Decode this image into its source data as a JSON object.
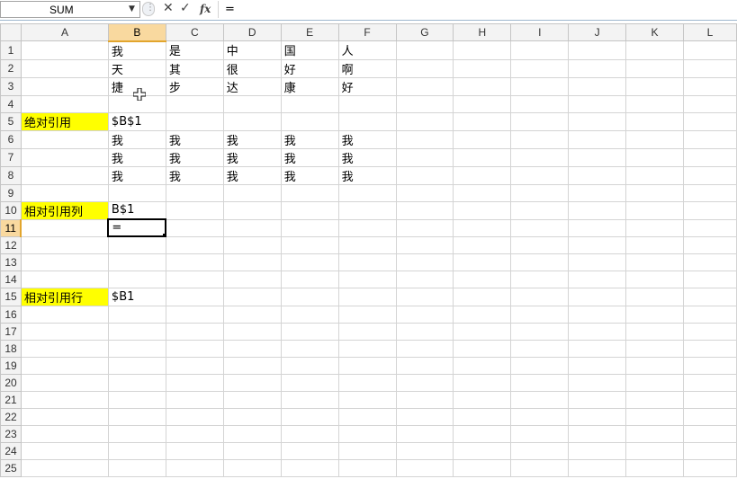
{
  "name_box": {
    "value": "SUM"
  },
  "formula_bar": {
    "cancel_icon": "✕",
    "enter_icon": "✓",
    "fx_label": "fx",
    "content": "="
  },
  "columns": [
    "A",
    "B",
    "C",
    "D",
    "E",
    "F",
    "G",
    "H",
    "I",
    "J",
    "K",
    "L"
  ],
  "selected_column": "B",
  "selected_row": "11",
  "rows": [
    {
      "n": "1",
      "cells": [
        "",
        "我",
        "是",
        "中",
        "国",
        "人",
        "",
        "",
        "",
        "",
        "",
        ""
      ]
    },
    {
      "n": "2",
      "cells": [
        "",
        "天",
        "其",
        "很",
        "好",
        "啊",
        "",
        "",
        "",
        "",
        "",
        ""
      ]
    },
    {
      "n": "3",
      "cells": [
        "",
        "捷",
        "步",
        "达",
        "康",
        "好",
        "",
        "",
        "",
        "",
        "",
        ""
      ]
    },
    {
      "n": "4",
      "cells": [
        "",
        "",
        "",
        "",
        "",
        "",
        "",
        "",
        "",
        "",
        "",
        ""
      ]
    },
    {
      "n": "5",
      "cells": [
        "绝对引用",
        "$B$1",
        "",
        "",
        "",
        "",
        "",
        "",
        "",
        "",
        "",
        ""
      ]
    },
    {
      "n": "6",
      "cells": [
        "",
        "我",
        "我",
        "我",
        "我",
        "我",
        "",
        "",
        "",
        "",
        "",
        ""
      ]
    },
    {
      "n": "7",
      "cells": [
        "",
        "我",
        "我",
        "我",
        "我",
        "我",
        "",
        "",
        "",
        "",
        "",
        ""
      ]
    },
    {
      "n": "8",
      "cells": [
        "",
        "我",
        "我",
        "我",
        "我",
        "我",
        "",
        "",
        "",
        "",
        "",
        ""
      ]
    },
    {
      "n": "9",
      "cells": [
        "",
        "",
        "",
        "",
        "",
        "",
        "",
        "",
        "",
        "",
        "",
        ""
      ]
    },
    {
      "n": "10",
      "cells": [
        "相对引用列",
        "B$1",
        "",
        "",
        "",
        "",
        "",
        "",
        "",
        "",
        "",
        ""
      ]
    },
    {
      "n": "11",
      "cells": [
        "",
        "=",
        "",
        "",
        "",
        "",
        "",
        "",
        "",
        "",
        "",
        ""
      ]
    },
    {
      "n": "12",
      "cells": [
        "",
        "",
        "",
        "",
        "",
        "",
        "",
        "",
        "",
        "",
        "",
        ""
      ]
    },
    {
      "n": "13",
      "cells": [
        "",
        "",
        "",
        "",
        "",
        "",
        "",
        "",
        "",
        "",
        "",
        ""
      ]
    },
    {
      "n": "14",
      "cells": [
        "",
        "",
        "",
        "",
        "",
        "",
        "",
        "",
        "",
        "",
        "",
        ""
      ]
    },
    {
      "n": "15",
      "cells": [
        "相对引用行",
        "$B1",
        "",
        "",
        "",
        "",
        "",
        "",
        "",
        "",
        "",
        ""
      ]
    },
    {
      "n": "16",
      "cells": [
        "",
        "",
        "",
        "",
        "",
        "",
        "",
        "",
        "",
        "",
        "",
        ""
      ]
    },
    {
      "n": "17",
      "cells": [
        "",
        "",
        "",
        "",
        "",
        "",
        "",
        "",
        "",
        "",
        "",
        ""
      ]
    },
    {
      "n": "18",
      "cells": [
        "",
        "",
        "",
        "",
        "",
        "",
        "",
        "",
        "",
        "",
        "",
        ""
      ]
    },
    {
      "n": "19",
      "cells": [
        "",
        "",
        "",
        "",
        "",
        "",
        "",
        "",
        "",
        "",
        "",
        ""
      ]
    },
    {
      "n": "20",
      "cells": [
        "",
        "",
        "",
        "",
        "",
        "",
        "",
        "",
        "",
        "",
        "",
        ""
      ]
    },
    {
      "n": "21",
      "cells": [
        "",
        "",
        "",
        "",
        "",
        "",
        "",
        "",
        "",
        "",
        "",
        ""
      ]
    },
    {
      "n": "22",
      "cells": [
        "",
        "",
        "",
        "",
        "",
        "",
        "",
        "",
        "",
        "",
        "",
        ""
      ]
    },
    {
      "n": "23",
      "cells": [
        "",
        "",
        "",
        "",
        "",
        "",
        "",
        "",
        "",
        "",
        "",
        ""
      ]
    },
    {
      "n": "24",
      "cells": [
        "",
        "",
        "",
        "",
        "",
        "",
        "",
        "",
        "",
        "",
        "",
        ""
      ]
    },
    {
      "n": "25",
      "cells": [
        "",
        "",
        "",
        "",
        "",
        "",
        "",
        "",
        "",
        "",
        "",
        ""
      ]
    }
  ],
  "highlight_color": "#ffff00",
  "highlighted_cells": [
    "A5",
    "A10",
    "A15"
  ]
}
